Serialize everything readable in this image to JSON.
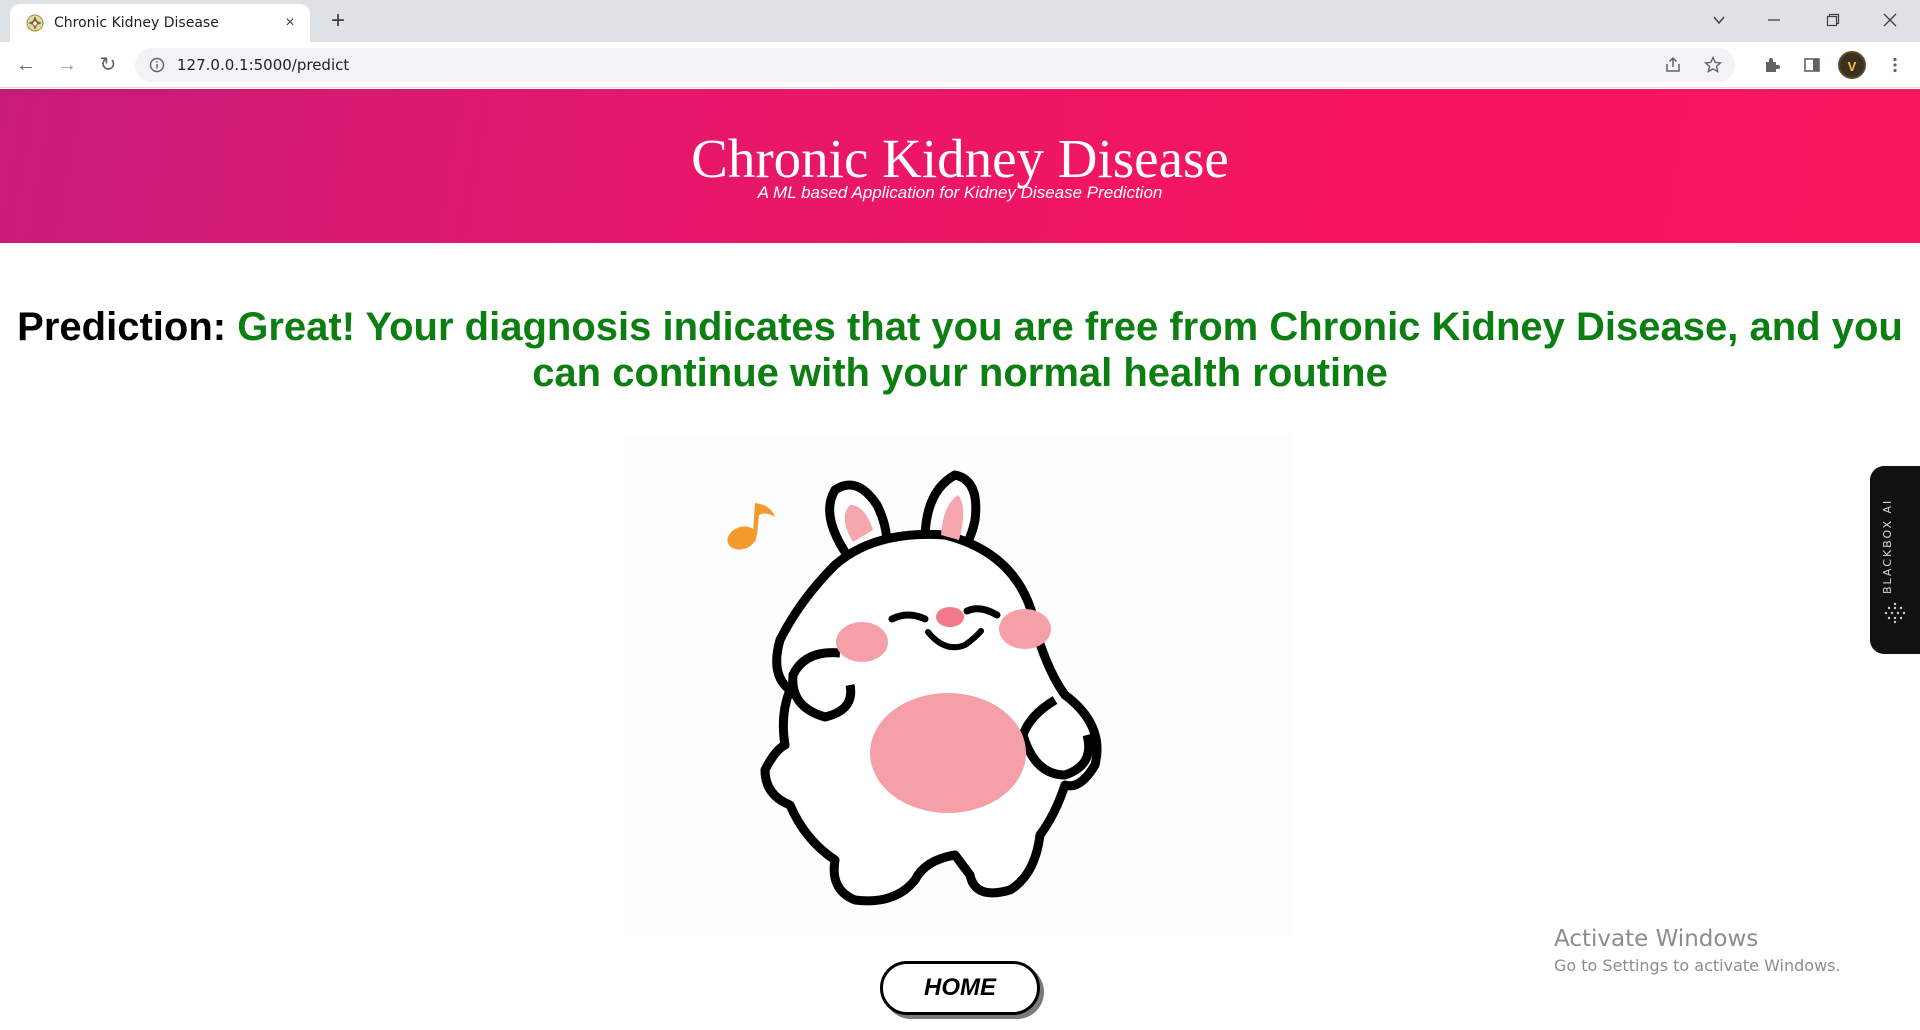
{
  "browser": {
    "tab": {
      "title": "Chronic Kidney Disease",
      "favicon": "kidney-logo-icon",
      "close_icon": "×"
    },
    "new_tab_icon": "+",
    "window_controls": {
      "tab_search": "⌄",
      "minimize": "—",
      "restore": "❐",
      "close": "✕"
    },
    "nav": {
      "back": "←",
      "forward": "→",
      "reload": "↻"
    },
    "url": "127.0.0.1:5000/predict",
    "omnibox_icons": [
      "share-icon",
      "star-icon"
    ],
    "toolbar_icons": [
      "extensions-icon",
      "side-panel-icon",
      "menu-icon"
    ],
    "profile_initial": "V"
  },
  "hero": {
    "title": "Chronic Kidney Disease",
    "subtitle": "A ML based Application for Kidney Disease Prediction",
    "gradient_start": "#c71b7a",
    "gradient_end": "#f7175d"
  },
  "prediction": {
    "label": "Prediction:",
    "result": "Great! Your diagnosis indicates that you are free from Chronic Kidney Disease, and you can continue with your normal health routine",
    "result_color": "#0d7f12"
  },
  "mascot": {
    "description_icon": "dancing-bunny-image"
  },
  "home_button": {
    "label": "HOME"
  },
  "blackbox": {
    "label": "BLACKBOX AI"
  },
  "watermark": {
    "title": "Activate Windows",
    "subtitle": "Go to Settings to activate Windows."
  }
}
